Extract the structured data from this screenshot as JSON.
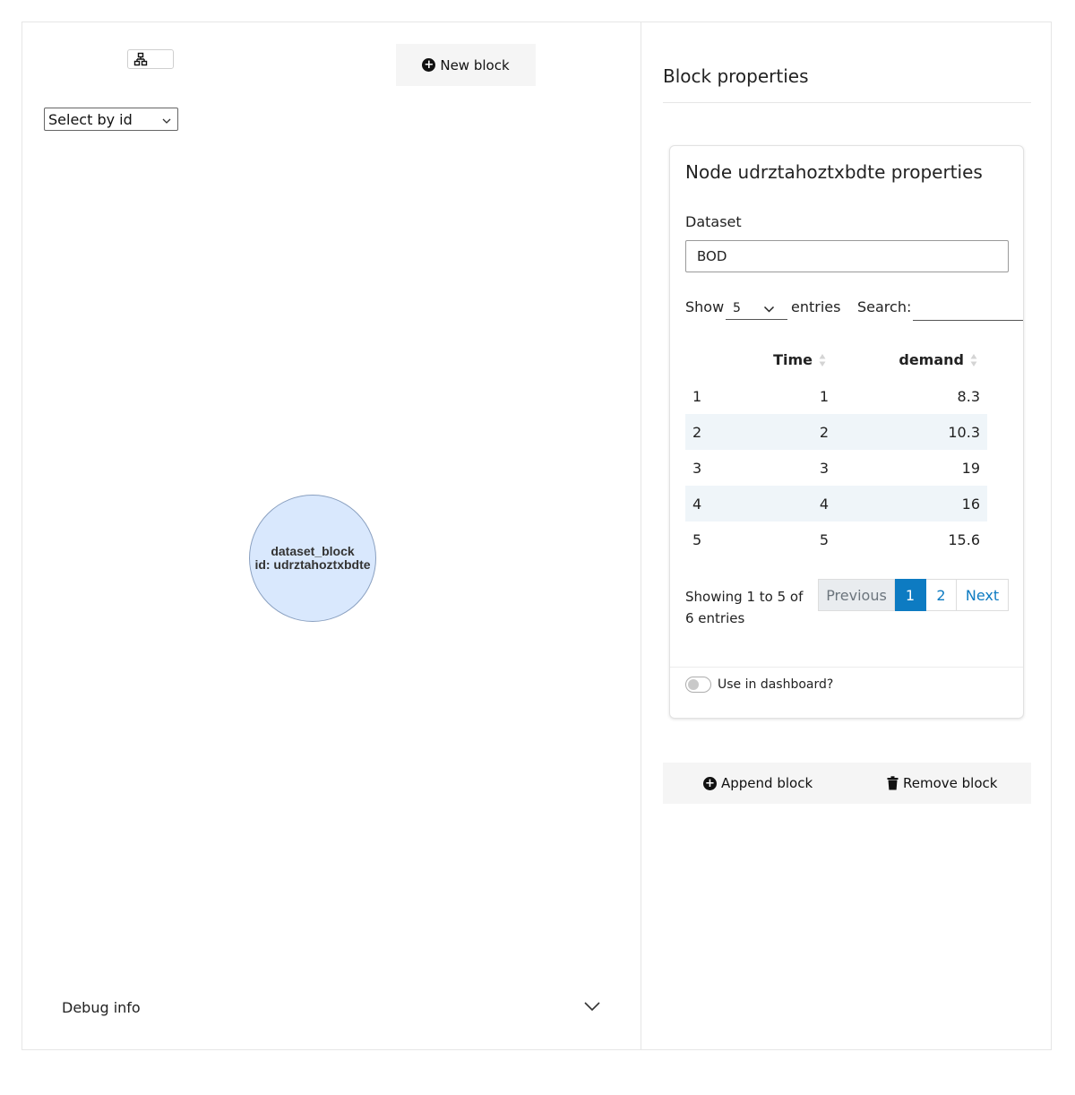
{
  "toolbar": {
    "layout_icon": "network-layout-icon",
    "new_block_label": "New block",
    "select_by_id_label": "Select by id"
  },
  "graph": {
    "node": {
      "title": "dataset_block",
      "id_label": "id: udrztahoztxbdte",
      "fill": "#d9e8fd"
    }
  },
  "debug": {
    "label": "Debug info"
  },
  "panel": {
    "title": "Block properties",
    "card_title": "Node udrztahoztxbdte properties",
    "dataset_label": "Dataset",
    "dataset_value": "BOD",
    "table_controls": {
      "show_label": "Show",
      "entries_value": "5",
      "entries_label": "entries",
      "search_label": "Search:",
      "search_value": ""
    },
    "table": {
      "columns": [
        "Time",
        "demand"
      ],
      "rows": [
        {
          "idx": "1",
          "time": "1",
          "demand": "8.3"
        },
        {
          "idx": "2",
          "time": "2",
          "demand": "10.3"
        },
        {
          "idx": "3",
          "time": "3",
          "demand": "19"
        },
        {
          "idx": "4",
          "time": "4",
          "demand": "16"
        },
        {
          "idx": "5",
          "time": "5",
          "demand": "15.6"
        }
      ],
      "info": "Showing 1 to 5 of 6 entries",
      "pagination": {
        "previous": "Previous",
        "pages": [
          "1",
          "2"
        ],
        "current": "1",
        "next": "Next"
      }
    },
    "use_in_dashboard_label": "Use in dashboard?",
    "use_in_dashboard_on": false,
    "append_label": "Append block",
    "remove_label": "Remove block"
  },
  "colors": {
    "accent": "#0d7bc2",
    "stripe": "#eff5f9",
    "button_bg": "#f5f5f5"
  }
}
